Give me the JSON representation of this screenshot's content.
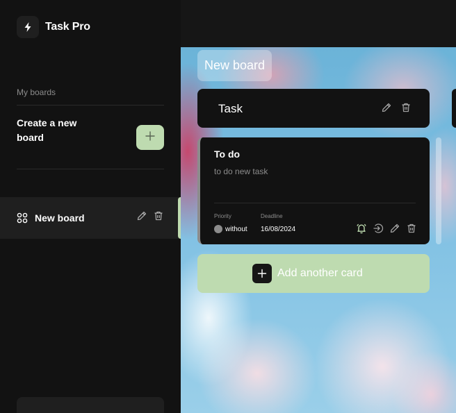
{
  "app": {
    "name": "Task Pro"
  },
  "sidebar": {
    "section_label": "My boards",
    "create_label": "Create a new board",
    "boards": [
      {
        "name": "New board",
        "active": true
      }
    ]
  },
  "board": {
    "title": "New board",
    "columns": [
      {
        "title": "Task",
        "cards": [
          {
            "title": "To do",
            "description": "to do new task",
            "priority_label": "Priority",
            "priority": "without",
            "deadline_label": "Deadline",
            "deadline": "16/08/2024"
          }
        ],
        "add_label": "Add another card"
      }
    ]
  },
  "colors": {
    "accent": "#bedbb0",
    "sidebar_bg": "#121212",
    "card_bg": "#121212",
    "priority_without": "#8c8c8c"
  },
  "icons": [
    "lightning-icon",
    "plus-icon",
    "four-circles-icon",
    "pencil-icon",
    "trash-icon",
    "bell-icon",
    "move-arrow-icon"
  ]
}
